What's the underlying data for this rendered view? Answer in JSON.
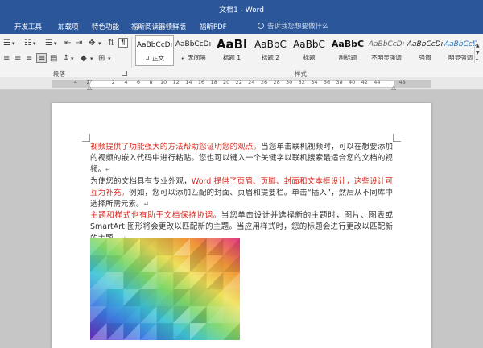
{
  "window": {
    "title": "文档1 - Word"
  },
  "tabs": [
    "开发工具",
    "加载项",
    "特色功能",
    "福昕阅读器领鲜版",
    "福昕PDF"
  ],
  "tell_me": {
    "placeholder": "告诉我您想要做什么"
  },
  "ribbon": {
    "paragraph_label": "段落",
    "styles_label": "样式",
    "styles": [
      {
        "preview": "AaBbCcDı",
        "name": "↲ 正文",
        "active": true
      },
      {
        "preview": "AaBbCcDı",
        "name": "↲ 无间隔"
      },
      {
        "preview": "AaBl",
        "name": "标题 1"
      },
      {
        "preview": "AaBbC",
        "name": "标题 2"
      },
      {
        "preview": "AaBbC",
        "name": "标题"
      },
      {
        "preview": "AaBbC",
        "name": "副标题"
      },
      {
        "preview": "AaBbCcDı",
        "name": "不明显强调"
      },
      {
        "preview": "AaBbCcDı",
        "name": "强调"
      },
      {
        "preview": "AaBbCcDı",
        "name": "明显强调"
      }
    ]
  },
  "ruler": {
    "marks": [
      "4",
      "2",
      "",
      "2",
      "4",
      "6",
      "8",
      "10",
      "12",
      "14",
      "16",
      "18",
      "20",
      "22",
      "24",
      "26",
      "28",
      "30",
      "32",
      "34",
      "36",
      "38",
      "40",
      "42",
      "44",
      "",
      "48"
    ]
  },
  "document": {
    "para1_red": "视频提供了功能强大的方法帮助您证明您的观点。",
    "para1_rest": "当您单击联机视频时，可以在想要添加的视频的嵌入代码中进行粘贴。您也可以键入一个关键字以联机搜索最适合您的文档的视频。",
    "para2_start": "为使您的文档具有专业外观，",
    "para2_red": "Word 提供了页眉、页脚、封面和文本框设计，这些设计可互为补充。",
    "para2_rest": "例如，您可以添加匹配的封面、页眉和提要栏。单击“插入”，然后从不同库中选择所需元素。",
    "para3_red": "主题和样式也有助于文档保持协调。",
    "para3_rest": "当您单击设计并选择新的主题时，图片、图表或 SmartArt 图形将会更改以匹配新的主题。当应用样式时，您的标题会进行更改以匹配新的主题。",
    "para_mark": "↵"
  },
  "colors": {
    "title_bar": "#2b579a",
    "accent_text": "#d9261c"
  }
}
